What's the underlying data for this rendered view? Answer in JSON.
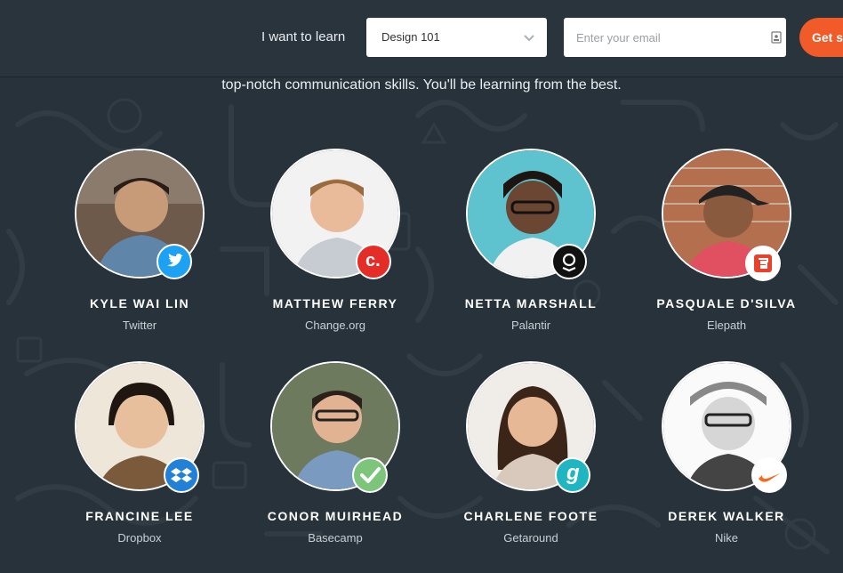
{
  "header": {
    "learn_label": "I want to learn",
    "course_select": {
      "value": "Design 101"
    },
    "email": {
      "placeholder": "Enter your email",
      "value": ""
    },
    "cta_label": "Get s"
  },
  "intro_text": "top-notch communication skills. You'll be learning from the best.",
  "colors": {
    "background": "#28323a",
    "cta": "#f15a29"
  },
  "mentors": [
    {
      "name": "KYLE WAI LIN",
      "company": "Twitter",
      "badge_icon": "twitter-icon"
    },
    {
      "name": "MATTHEW FERRY",
      "company": "Change.org",
      "badge_icon": "change-org-icon"
    },
    {
      "name": "NETTA MARSHALL",
      "company": "Palantir",
      "badge_icon": "palantir-icon"
    },
    {
      "name": "PASQUALE D'SILVA",
      "company": "Elepath",
      "badge_icon": "elepath-icon"
    },
    {
      "name": "FRANCINE LEE",
      "company": "Dropbox",
      "badge_icon": "dropbox-icon"
    },
    {
      "name": "CONOR MUIRHEAD",
      "company": "Basecamp",
      "badge_icon": "basecamp-icon"
    },
    {
      "name": "CHARLENE FOOTE",
      "company": "Getaround",
      "badge_icon": "getaround-icon"
    },
    {
      "name": "DEREK WALKER",
      "company": "Nike",
      "badge_icon": "nike-icon"
    }
  ],
  "badge_marks": {
    "change_org": "c.",
    "getaround": "g"
  }
}
